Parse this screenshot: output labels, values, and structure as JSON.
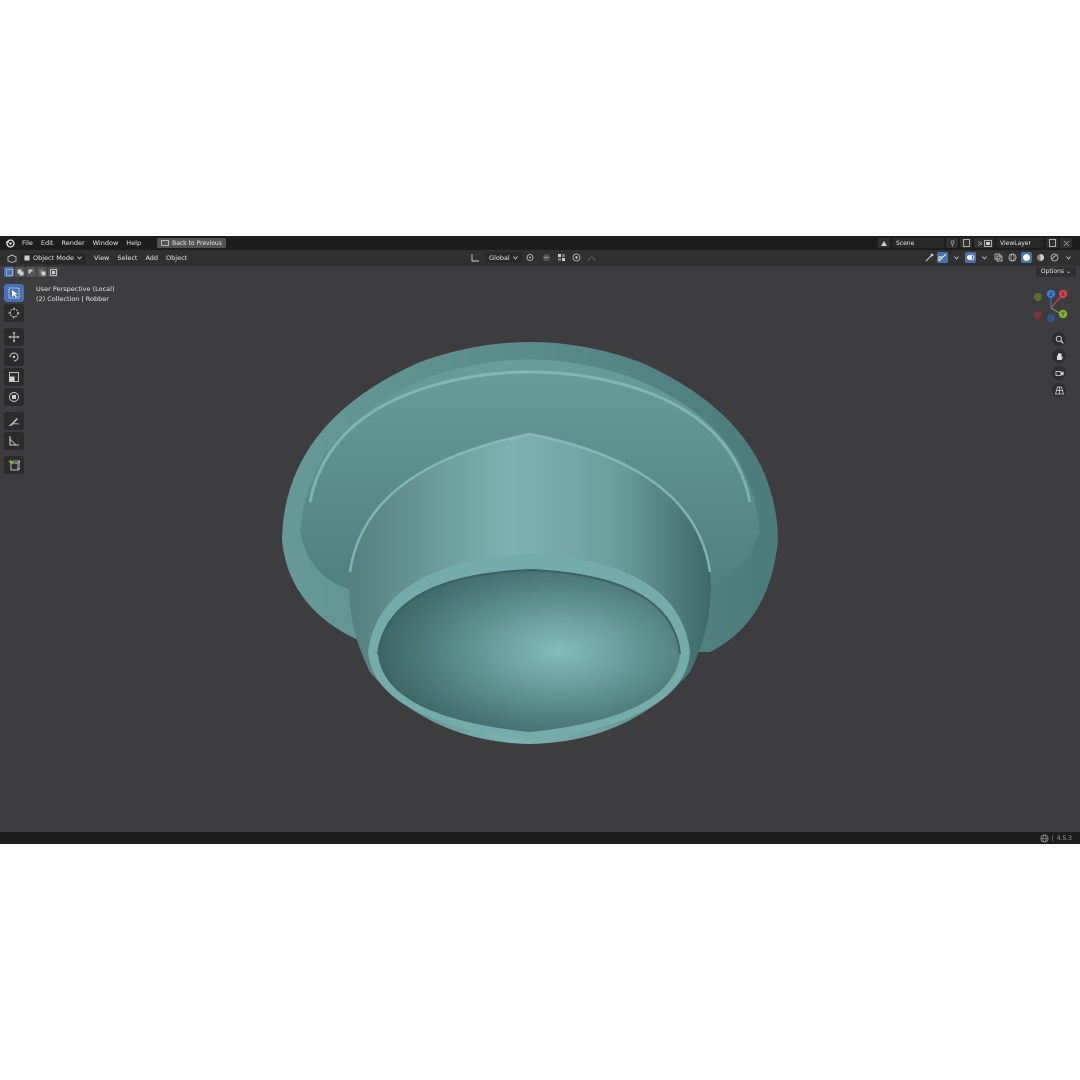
{
  "topbar": {
    "menu": [
      "File",
      "Edit",
      "Render",
      "Window",
      "Help"
    ],
    "back_button": "Back to Previous",
    "scene": "Scene",
    "view_layer": "ViewLayer"
  },
  "header": {
    "editor_type_icon": "3d-viewport-icon",
    "mode": "Object Mode",
    "menu": [
      "View",
      "Select",
      "Add",
      "Object"
    ],
    "transform_orientation": "Global"
  },
  "header3": {
    "options": "Options"
  },
  "viewport": {
    "perspective": "User Perspective (Local)",
    "collection": "(2) Collection | Robber",
    "object_color": "#6fa3a3"
  },
  "gizmo": {
    "x_label": "X",
    "y_label": "Y",
    "z_label": "Z",
    "x_color": "#d8404e",
    "y_color": "#7fb12f",
    "z_color": "#3a78d4"
  },
  "status": {
    "version": "4.5.3"
  },
  "colors": {
    "background": "#3d3c3f",
    "topbar": "#1d1d1d",
    "header": "#303030",
    "accent": "#4772b3"
  }
}
